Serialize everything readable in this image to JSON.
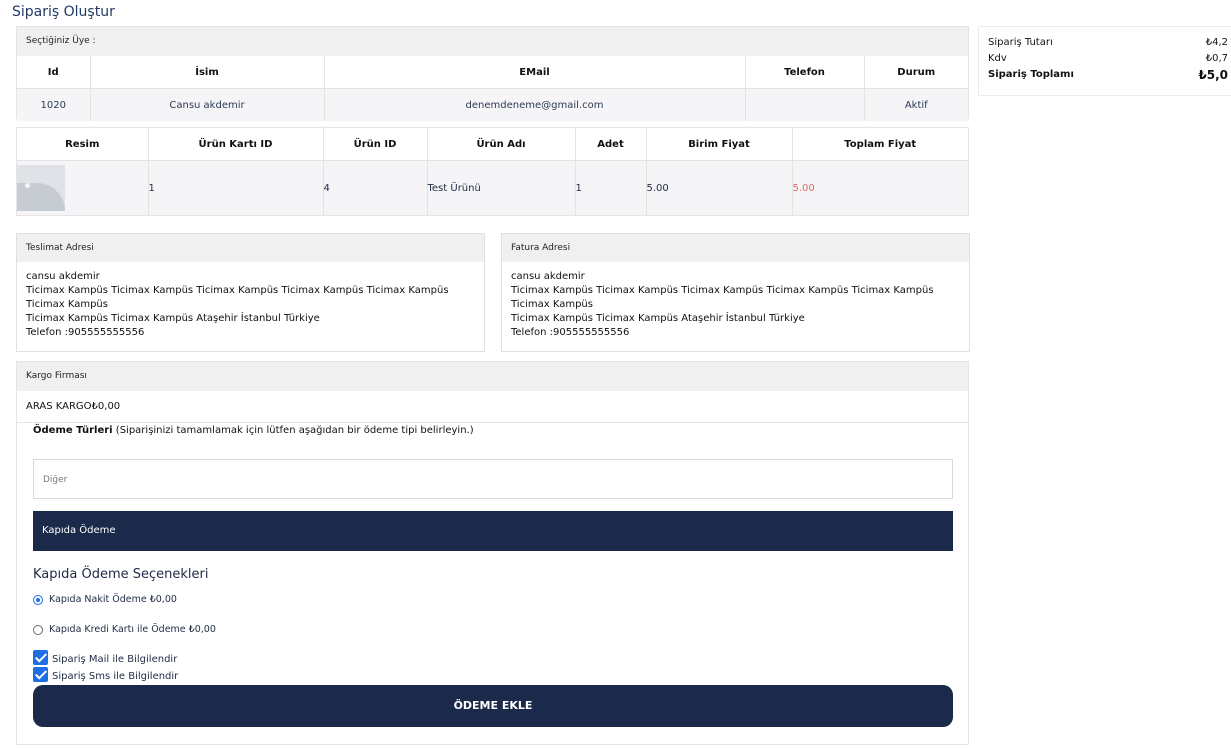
{
  "page_title": "Sipariş Oluştur",
  "member": {
    "heading": "Seçtiğiniz Üye :",
    "columns": [
      "Id",
      "İsim",
      "EMail",
      "Telefon",
      "Durum"
    ],
    "row": {
      "id": "1020",
      "name": "Cansu akdemir",
      "email": "denemdeneme@gmail.com",
      "phone": "",
      "status": "Aktif"
    }
  },
  "products": {
    "columns": [
      "Resim",
      "Ürün Kartı ID",
      "Ürün ID",
      "Ürün Adı",
      "Adet",
      "Birim Fiyat",
      "Toplam Fiyat"
    ],
    "row": {
      "card_id": "1",
      "product_id": "4",
      "name": "Test Ürünü",
      "qty": "1",
      "unit_price": "5.00",
      "total": "5.00",
      "image_icon": "image-placeholder-icon"
    }
  },
  "shipping_address": {
    "heading": "Teslimat Adresi",
    "lines": [
      "cansu akdemir",
      "Ticimax Kampüs Ticimax Kampüs Ticimax Kampüs Ticimax Kampüs Ticimax Kampüs Ticimax Kampüs",
      "Ticimax Kampüs Ticimax Kampüs Ataşehir İstanbul Türkiye",
      "Telefon :905555555556"
    ]
  },
  "billing_address": {
    "heading": "Fatura Adresi",
    "lines": [
      "cansu akdemir",
      "Ticimax Kampüs Ticimax Kampüs Ticimax Kampüs Ticimax Kampüs Ticimax Kampüs Ticimax Kampüs",
      "Ticimax Kampüs Ticimax Kampüs Ataşehir İstanbul Türkiye",
      "Telefon :905555555556"
    ]
  },
  "cargo": {
    "heading": "Kargo Firması",
    "value": "ARAS KARGO₺0,00"
  },
  "payment": {
    "title": "Ödeme Türleri",
    "hint": " (Siparişinizi tamamlamak için lütfen aşağıdan bir ödeme tipi belirleyin.)",
    "other_label": "Diğer",
    "active_tab": "Kapıda Ödeme",
    "options_title": "Kapıda Ödeme Seçenekleri",
    "options": [
      {
        "label": "Kapıda Nakit Ödeme ₺0,00",
        "selected": true
      },
      {
        "label": "Kapıda Kredi Kartı ile Ödeme ₺0,00",
        "selected": false
      }
    ],
    "notify_mail": "Sipariş Mail ile Bilgilendir",
    "notify_sms": "Sipariş Sms ile Bilgilendir",
    "submit_label": "ÖDEME EKLE"
  },
  "summary": {
    "subtotal_label": "Sipariş Tutarı",
    "subtotal_value": "₺4,2",
    "tax_label": "Kdv",
    "tax_value": "₺0,7",
    "total_label": "Sipariş Toplamı",
    "total_value": "₺5,0"
  },
  "colors": {
    "navy": "#1b2a4a",
    "accent": "#1e6fe3",
    "price_red": "#e06a6a"
  }
}
